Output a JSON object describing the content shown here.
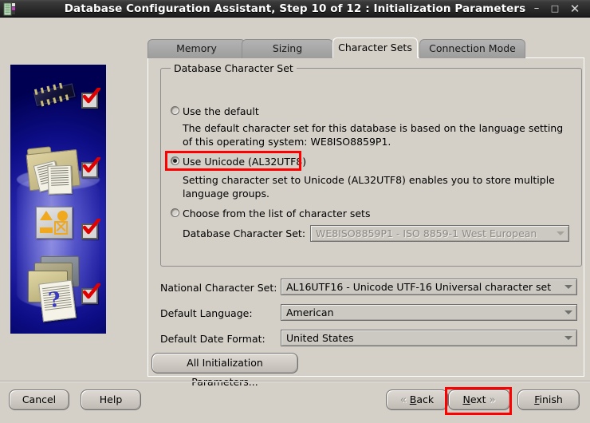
{
  "window": {
    "title": "Database Configuration Assistant, Step 10 of 12 : Initialization Parameters",
    "icon": "database-icon",
    "minimize_label": "–",
    "maximize_label": "□",
    "close_label": "✕"
  },
  "tabs": [
    {
      "label": "Memory",
      "selected": false
    },
    {
      "label": "Sizing",
      "selected": false
    },
    {
      "label": "Character Sets",
      "selected": true
    },
    {
      "label": "Connection Mode",
      "selected": false
    }
  ],
  "group": {
    "title": "Database Character Set",
    "options": [
      {
        "label": "Use the default",
        "selected": false,
        "description": "The default character set for this database is based on the language setting of this operating system: WE8ISO8859P1.",
        "highlighted": false
      },
      {
        "label": "Use Unicode (AL32UTF8)",
        "selected": true,
        "description": "Setting character set to Unicode (AL32UTF8) enables you to store multiple language groups.",
        "highlighted": true
      },
      {
        "label": "Choose from the list of character sets",
        "selected": false,
        "description": "",
        "highlighted": false
      }
    ],
    "charset_field": {
      "label": "Database Character Set:",
      "value": "WE8ISO8859P1 - ISO 8859-1 West European",
      "disabled": true
    }
  },
  "fields": [
    {
      "label": "National Character Set:",
      "value": "AL16UTF16 - Unicode UTF-16 Universal character set"
    },
    {
      "label": "Default Language:",
      "value": "American"
    },
    {
      "label": "Default Date Format:",
      "value": "United States"
    }
  ],
  "all_params_button": {
    "label": "All Initialization Parameters..."
  },
  "footer": {
    "cancel": "Cancel",
    "help": "Help",
    "back": {
      "prefix": "",
      "accel": "B",
      "rest": "ack",
      "chevron": "«"
    },
    "next": {
      "accel": "N",
      "rest": "ext",
      "chevron": "»",
      "highlighted": true
    },
    "finish": {
      "accel": "F",
      "rest": "inish"
    }
  },
  "colors": {
    "highlight": "#ff0000",
    "window_bg": "#d4d0c8",
    "sidebar_blue": "#0a0a9e",
    "titlebar": "#272727"
  }
}
